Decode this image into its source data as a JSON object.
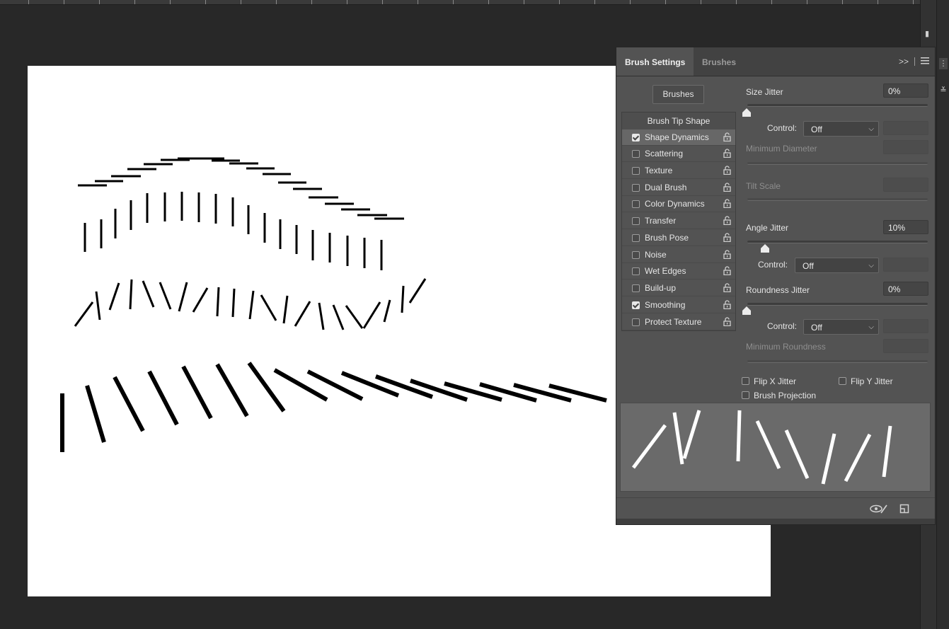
{
  "app": {
    "dock_icons": [
      "properties-icon",
      "libraries-icon",
      "panel-icon",
      "adjust-icon"
    ]
  },
  "panel": {
    "tabs": [
      "Brush Settings",
      "Brushes"
    ],
    "active_tab": "Brush Settings",
    "menu_icons": [
      "expand-icon",
      "panel-menu-icon"
    ],
    "brushes_button": "Brushes",
    "list_header": "Brush Tip Shape",
    "items": [
      {
        "label": "Shape Dynamics",
        "checked": true,
        "selected": true
      },
      {
        "label": "Scattering",
        "checked": false
      },
      {
        "label": "Texture",
        "checked": false
      },
      {
        "label": "Dual Brush",
        "checked": false
      },
      {
        "label": "Color Dynamics",
        "checked": false
      },
      {
        "label": "Transfer",
        "checked": false
      },
      {
        "label": "Brush Pose",
        "checked": false
      },
      {
        "label": "Noise",
        "checked": false
      },
      {
        "label": "Wet Edges",
        "checked": false
      },
      {
        "label": "Build-up",
        "checked": false
      },
      {
        "label": "Smoothing",
        "checked": true
      },
      {
        "label": "Protect Texture",
        "checked": false
      }
    ],
    "size_jitter": {
      "label": "Size Jitter",
      "value": "0%",
      "level": 0
    },
    "size_control": {
      "label": "Control:",
      "value": "Off"
    },
    "min_diameter": {
      "label": "Minimum Diameter"
    },
    "tilt_scale": {
      "label": "Tilt Scale"
    },
    "angle_jitter": {
      "label": "Angle Jitter",
      "value": "10%",
      "level": 0.1
    },
    "angle_control": {
      "label": "Control:",
      "value": "Off"
    },
    "roundness_jitter": {
      "label": "Roundness Jitter",
      "value": "0%",
      "level": 0
    },
    "roundness_control": {
      "label": "Control:",
      "value": "Off"
    },
    "min_roundness": {
      "label": "Minimum Roundness"
    },
    "flip_x": {
      "label": "Flip X Jitter",
      "checked": false
    },
    "flip_y": {
      "label": "Flip Y Jitter",
      "checked": false
    },
    "brush_projection": {
      "label": "Brush Projection",
      "checked": false
    },
    "footer_icons": [
      "toggle-preview-icon",
      "new-brush-icon"
    ]
  }
}
